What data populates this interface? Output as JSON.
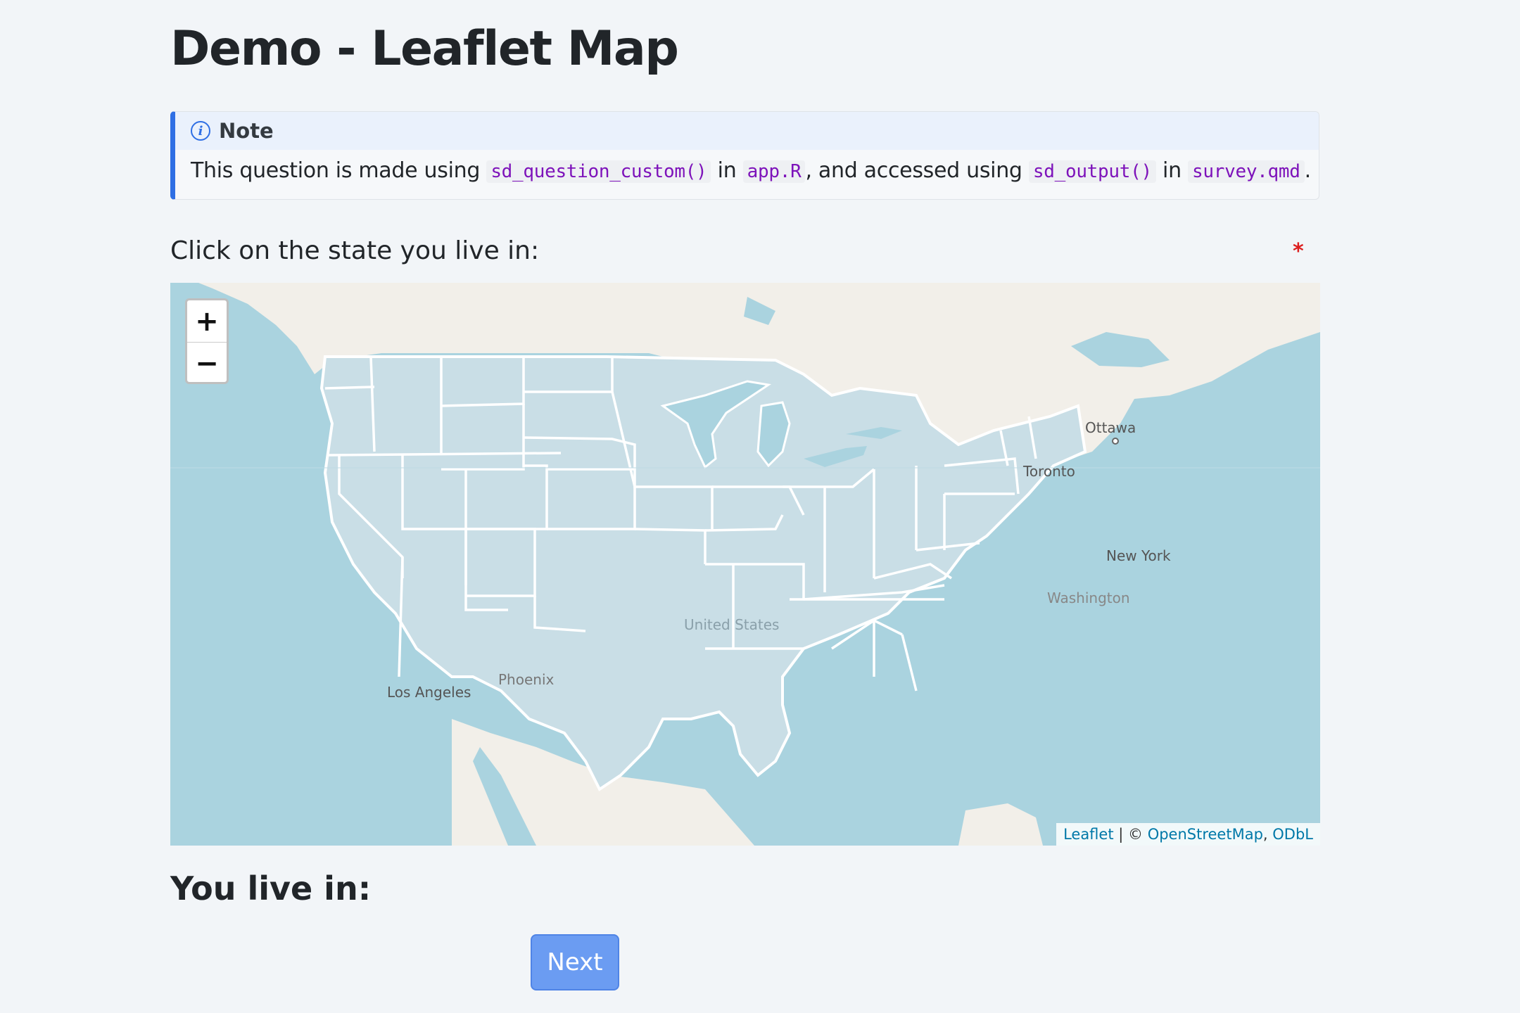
{
  "page": {
    "title": "Demo - Leaflet Map"
  },
  "callout": {
    "icon": "info-icon",
    "title": "Note",
    "text_1": "This question is made using",
    "code_1": "sd_question_custom()",
    "text_2": "in",
    "code_2": "app.R",
    "text_3": ", and accessed using",
    "code_3": "sd_output()",
    "text_4": "in",
    "code_4": "survey.qmd",
    "text_5": "."
  },
  "question": {
    "label": "Click on the state you live in:",
    "required_marker": "*"
  },
  "map": {
    "zoom_in_label": "+",
    "zoom_out_label": "−",
    "labels": {
      "ottawa": "Ottawa",
      "toronto": "Toronto",
      "new_york": "New York",
      "washington": "Washington",
      "united_states": "United States",
      "phoenix": "Phoenix",
      "los_angeles": "Los Angeles"
    },
    "attribution": {
      "leaflet": "Leaflet",
      "separator": " | © ",
      "osm": "OpenStreetMap",
      "comma": ", ",
      "odbl": "ODbL"
    },
    "colors": {
      "water": "#aad3df",
      "land": "#f2efe9",
      "state_fill": "#c9dee6",
      "state_border": "#ffffff"
    }
  },
  "answer": {
    "label": "You live in:"
  },
  "buttons": {
    "next_label": "Next"
  }
}
